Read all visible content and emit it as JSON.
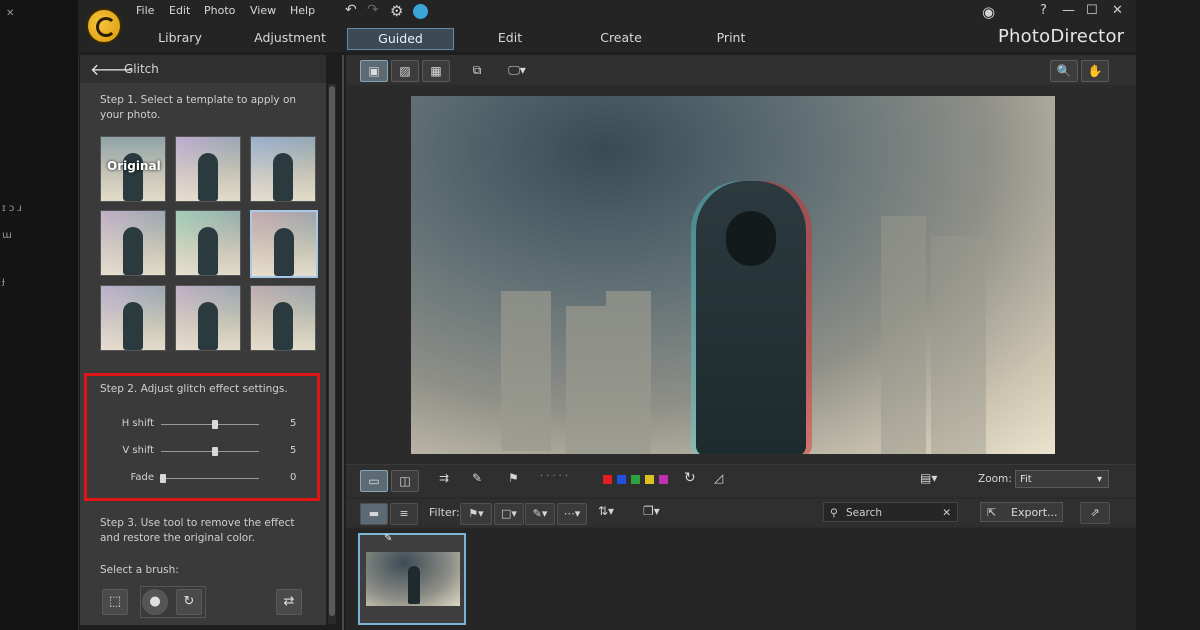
{
  "menu": [
    "File",
    "Edit",
    "Photo",
    "View",
    "Help"
  ],
  "tabs": [
    {
      "label": "Library"
    },
    {
      "label": "Adjustment"
    },
    {
      "label": "Guided"
    },
    {
      "label": "Edit"
    },
    {
      "label": "Create"
    },
    {
      "label": "Print"
    }
  ],
  "brand": "PhotoDirector",
  "window_controls": {
    "help": "?",
    "minimize": "—",
    "maximize": "☐",
    "close": "✕"
  },
  "panel": {
    "title": "Glitch",
    "step1": "Step 1. Select a template to apply on your photo.",
    "templates": [
      {
        "label": "Original",
        "tint": ""
      },
      {
        "label": "",
        "tint": "#c030d0"
      },
      {
        "label": "",
        "tint": "#3040d0"
      },
      {
        "label": "",
        "tint": "#d040a0"
      },
      {
        "label": "",
        "tint": "#50d050"
      },
      {
        "label": "",
        "tint": "#e02020"
      },
      {
        "label": "",
        "tint": "#c040c0"
      },
      {
        "label": "",
        "tint": "#d04090"
      },
      {
        "label": "",
        "tint": "#d03030"
      }
    ],
    "selected_template_index": 5,
    "step2": "Step 2. Adjust glitch effect settings.",
    "sliders": [
      {
        "label": "H shift",
        "value": "5",
        "level": 0.55
      },
      {
        "label": "V shift",
        "value": "5",
        "level": 0.55
      },
      {
        "label": "Fade",
        "value": "0",
        "level": 0.02
      }
    ],
    "step3": "Step 3. Use tool to remove the effect and restore the original color.",
    "brush_label": "Select a brush:",
    "brushes": [
      "auto-brush-icon",
      "round-brush-icon",
      "smart-brush-icon",
      "swap-icon"
    ]
  },
  "view_icons": [
    "single-view-icon",
    "photo-view-icon",
    "grid-view-icon",
    "compare-icon",
    "monitor-icon"
  ],
  "zoom": {
    "label": "Zoom:",
    "value": "Fit"
  },
  "color_labels": [
    "#e02020",
    "#2050e0",
    "#30a040",
    "#e0c020",
    "#c030b0"
  ],
  "filter": {
    "label": "Filter:"
  },
  "search": {
    "placeholder": "Search"
  },
  "export": {
    "label": "Export..."
  }
}
